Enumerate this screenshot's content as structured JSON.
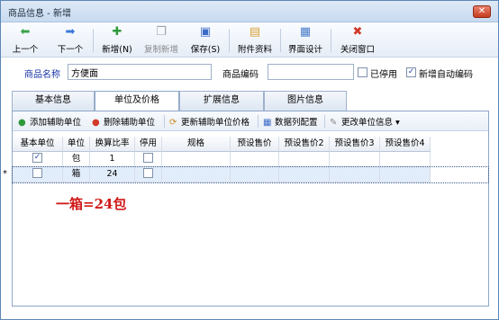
{
  "window": {
    "title": "商品信息 - 新增",
    "close_glyph": "✕"
  },
  "toolbar": {
    "buttons": [
      {
        "label": "上一个",
        "icon": "arrow-left-icon",
        "glyph": "⬅",
        "color": "#3aa34a",
        "disabled": false
      },
      {
        "label": "下一个",
        "icon": "arrow-right-icon",
        "glyph": "➡",
        "color": "#3d78d8",
        "disabled": false
      },
      {
        "label": "新增(N)",
        "icon": "add-icon",
        "glyph": "✚",
        "color": "#2f9a3c",
        "disabled": false
      },
      {
        "label": "复制新增",
        "icon": "copy-icon",
        "glyph": "❐",
        "color": "#9aa3ad",
        "disabled": true
      },
      {
        "label": "保存(S)",
        "icon": "save-icon",
        "glyph": "▣",
        "color": "#3d6cc7",
        "disabled": false
      },
      {
        "label": "附件资料",
        "icon": "attachment-icon",
        "glyph": "▤",
        "color": "#d9a23a",
        "disabled": false
      },
      {
        "label": "界面设计",
        "icon": "layout-design-icon",
        "glyph": "▦",
        "color": "#4a7bc9",
        "disabled": false
      },
      {
        "label": "关闭窗口",
        "icon": "close-window-icon",
        "glyph": "✖",
        "color": "#d23a2a",
        "disabled": false
      }
    ]
  },
  "form": {
    "name_label": "商品名称",
    "name_value": "方便面",
    "code_label": "商品编码",
    "code_value": "",
    "disabled_label": "已停用",
    "disabled_checked": false,
    "autocode_label": "新增自动编码",
    "autocode_checked": true,
    "check_glyph": "✓"
  },
  "tabs": [
    {
      "label": "基本信息",
      "active": false
    },
    {
      "label": "单位及价格",
      "active": true
    },
    {
      "label": "扩展信息",
      "active": false
    },
    {
      "label": "图片信息",
      "active": false
    }
  ],
  "subtoolbar": {
    "add_unit": "添加辅助单位",
    "delete_unit": "删除辅助单位",
    "update_price": "更新辅助单位价格",
    "column_config": "数据列配置",
    "change_unit": "更改单位信息"
  },
  "grid": {
    "columns": [
      "基本单位",
      "单位",
      "换算比率",
      "停用",
      "规格",
      "预设售价",
      "预设售价2",
      "预设售价3",
      "预设售价4"
    ],
    "rows": [
      {
        "base_unit": true,
        "unit": "包",
        "ratio": "1",
        "stopped": false,
        "spec": "",
        "p1": "",
        "p2": "",
        "p3": "",
        "p4": "",
        "selected": false,
        "marker": ""
      },
      {
        "base_unit": false,
        "unit": "箱",
        "ratio": "24",
        "stopped": false,
        "spec": "",
        "p1": "",
        "p2": "",
        "p3": "",
        "p4": "",
        "selected": true,
        "marker": "*"
      }
    ]
  },
  "annotation": "一箱=24包"
}
